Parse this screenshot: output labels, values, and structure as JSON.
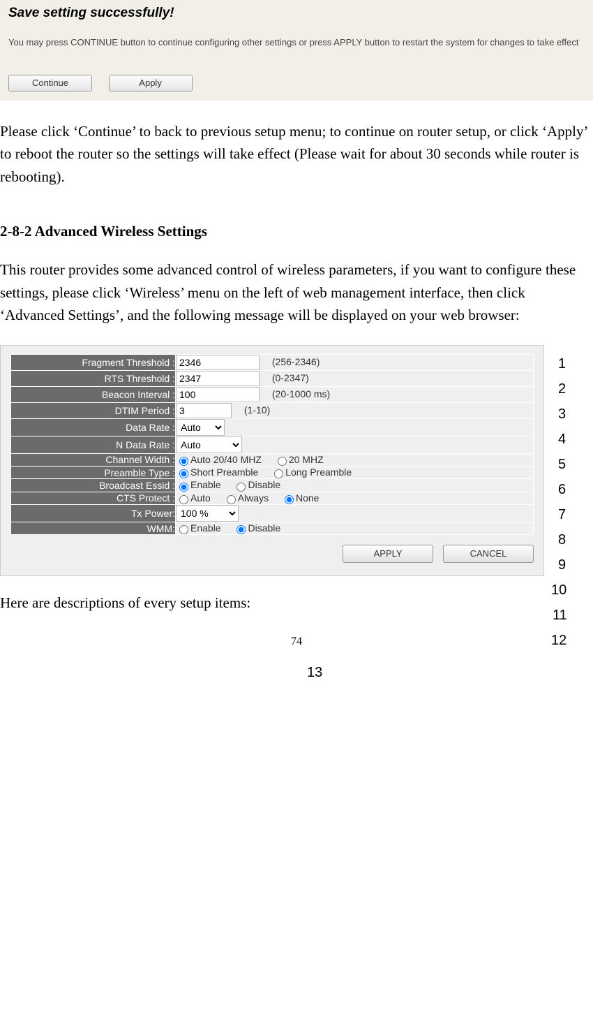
{
  "dialog": {
    "title": "Save setting successfully!",
    "text": "You may press CONTINUE button to continue configuring other settings or press APPLY button to restart the system for changes to take effect",
    "continue_label": "Continue",
    "apply_label": "Apply"
  },
  "para1": "Please click ‘Continue’ to back to previous setup menu; to continue on router setup, or click ‘Apply’ to reboot the router so the settings will take effect (Please wait for about 30 seconds while router is rebooting).",
  "heading": "2-8-2 Advanced Wireless Settings",
  "para2": "This router provides some advanced control of wireless parameters, if you want to configure these settings, please click ‘Wireless’ menu on the left of web management interface, then click ‘Advanced Settings’, and the following message will be displayed on your web browser:",
  "settings": {
    "fragment": {
      "label": "Fragment Threshold :",
      "value": "2346",
      "hint": "(256-2346)"
    },
    "rts": {
      "label": "RTS Threshold :",
      "value": "2347",
      "hint": "(0-2347)"
    },
    "beacon": {
      "label": "Beacon Interval :",
      "value": "100",
      "hint": "(20-1000 ms)"
    },
    "dtim": {
      "label": "DTIM Period :",
      "value": "3",
      "hint": "(1-10)"
    },
    "datarate": {
      "label": "Data Rate :",
      "selected": "Auto"
    },
    "ndatarate": {
      "label": "N Data Rate :",
      "selected": "Auto"
    },
    "chanwidth": {
      "label": "Channel Width :",
      "opt1": "Auto 20/40 MHZ",
      "opt2": "20 MHZ"
    },
    "preamble": {
      "label": "Preamble Type :",
      "opt1": "Short Preamble",
      "opt2": "Long Preamble"
    },
    "bcast": {
      "label": "Broadcast Essid :",
      "opt1": "Enable",
      "opt2": "Disable"
    },
    "cts": {
      "label": "CTS Protect :",
      "opt1": "Auto",
      "opt2": "Always",
      "opt3": "None"
    },
    "txpower": {
      "label": "Tx Power:",
      "selected": "100 %"
    },
    "wmm": {
      "label": "WMM:",
      "opt1": "Enable",
      "opt2": "Disable"
    }
  },
  "actions": {
    "apply": "APPLY",
    "cancel": "CANCEL"
  },
  "callouts": {
    "c1": "1",
    "c2": "2",
    "c3": "3",
    "c4": "4",
    "c5": "5",
    "c6": "6",
    "c7": "7",
    "c8": "8",
    "c9": "9",
    "c10": "10",
    "c11": "11",
    "c12": "12",
    "c13": "13"
  },
  "para3": "Here are descriptions of every setup items:",
  "page_number": "74"
}
